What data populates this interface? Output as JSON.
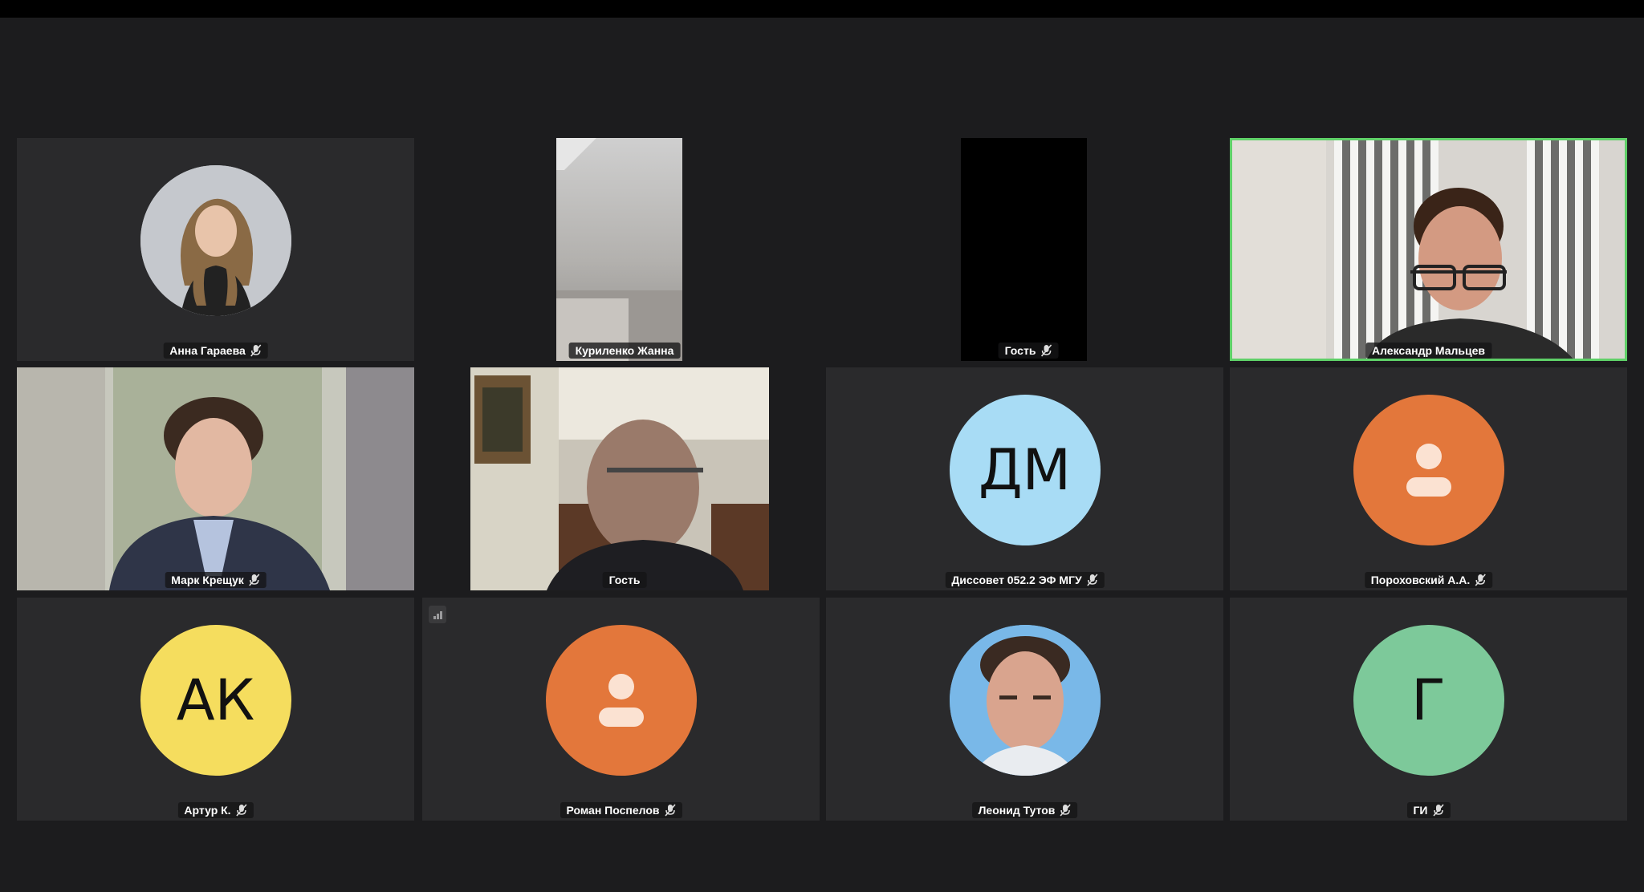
{
  "window": {
    "title": ""
  },
  "participants": [
    {
      "name": "Анна Гараева",
      "muted": true,
      "type": "photo-avatar"
    },
    {
      "name": "Куриленко Жанна",
      "muted": false,
      "type": "video"
    },
    {
      "name": "Гость",
      "muted": true,
      "type": "video-off"
    },
    {
      "name": "Александр Мальцев",
      "muted": false,
      "type": "video",
      "speaking": true
    },
    {
      "name": "Марк Крещук",
      "muted": true,
      "type": "video"
    },
    {
      "name": "Гость",
      "muted": false,
      "type": "video"
    },
    {
      "name": "Диссовет 052.2 ЭФ МГУ",
      "muted": true,
      "type": "initials",
      "initials": "ДМ",
      "color": "#a8dcf5"
    },
    {
      "name": "Пороховский А.А.",
      "muted": true,
      "type": "person-icon",
      "color": "#e3773b"
    },
    {
      "name": "Артур К.",
      "muted": true,
      "type": "initials",
      "initials": "АК",
      "color": "#f5dd5e"
    },
    {
      "name": "Роман Поспелов",
      "muted": true,
      "type": "person-icon",
      "color": "#e3773b"
    },
    {
      "name": "Леонид Тутов",
      "muted": true,
      "type": "photo-avatar"
    },
    {
      "name": "ГИ",
      "muted": true,
      "type": "initials",
      "initials": "Г",
      "color": "#7dc99a"
    }
  ],
  "colors": {
    "background": "#1c1c1e",
    "tile": "#2a2a2c",
    "speaking_border": "#5fd068"
  }
}
